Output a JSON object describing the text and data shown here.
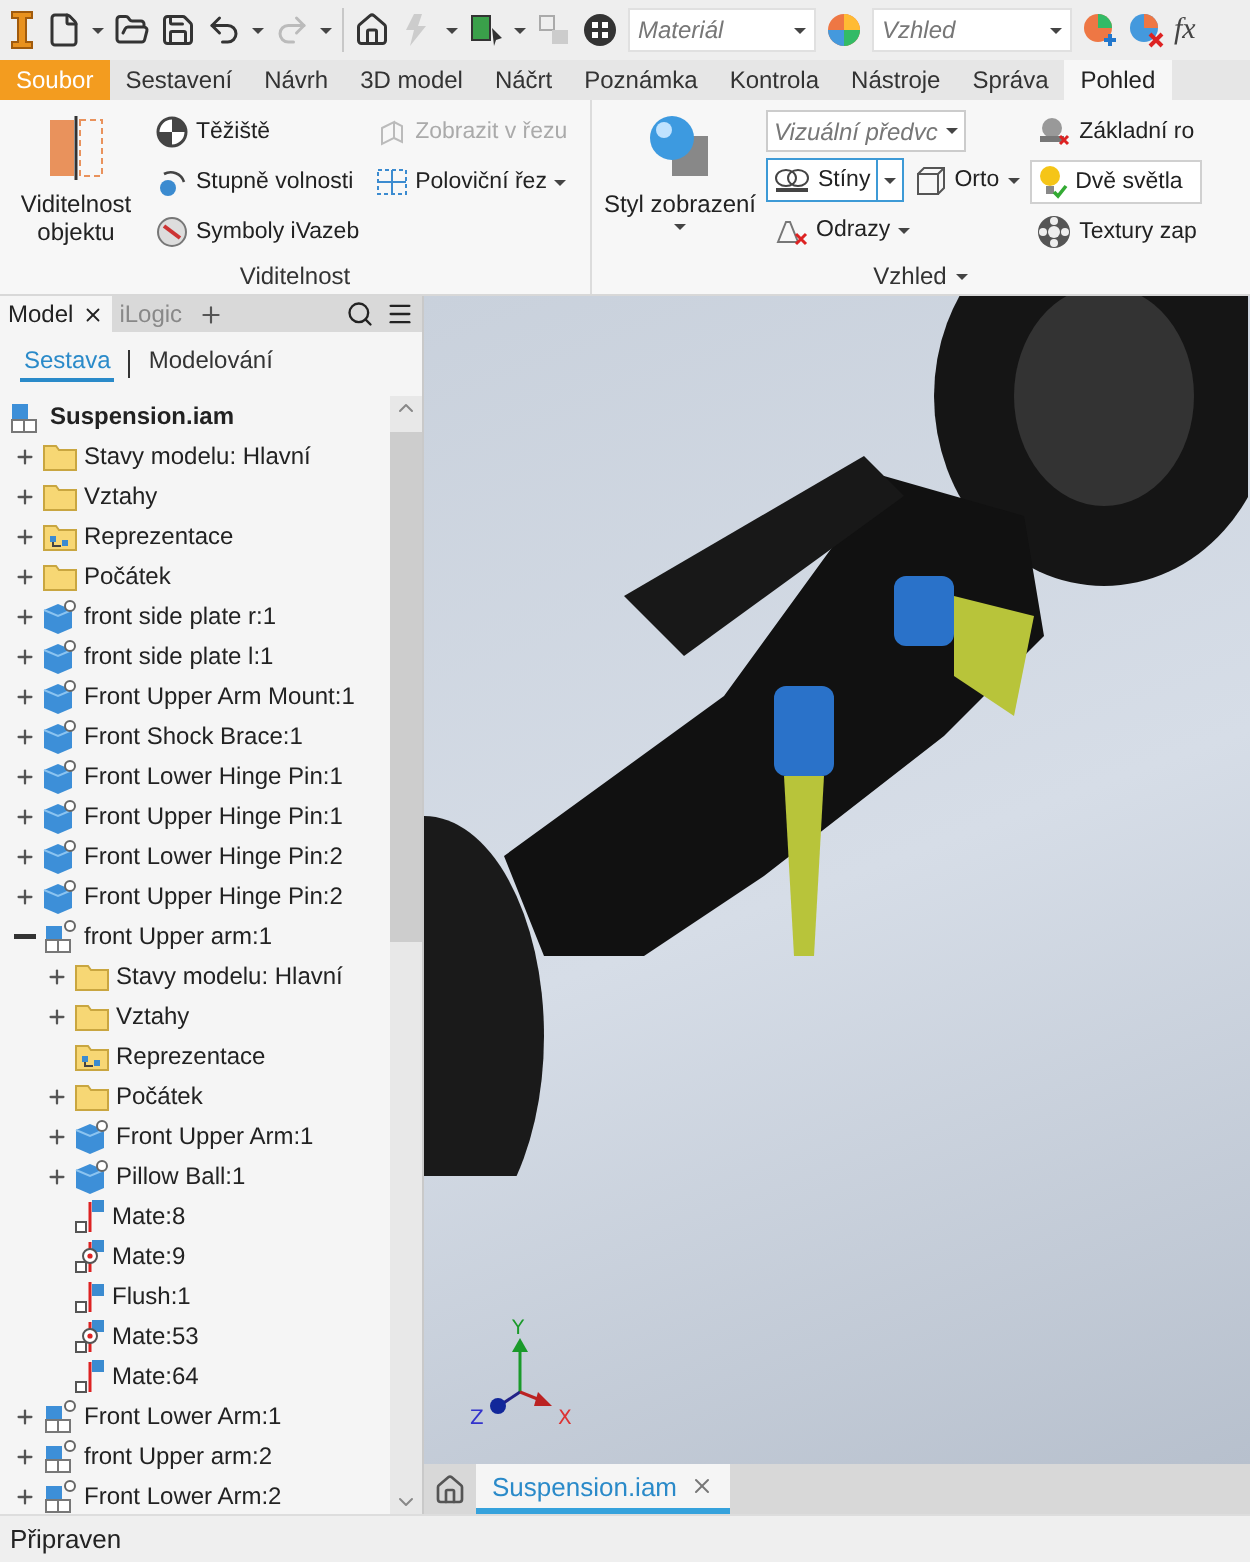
{
  "quick_access": {
    "material_field": {
      "placeholder": "Materiál"
    },
    "appearance_field": {
      "placeholder": "Vzhled"
    },
    "function_label": "fx"
  },
  "ribbon_tabs": [
    {
      "label": "Soubor",
      "kind": "file",
      "selected": false
    },
    {
      "label": "Sestavení",
      "kind": "tab",
      "selected": false
    },
    {
      "label": "Návrh",
      "kind": "tab",
      "selected": false
    },
    {
      "label": "3D model",
      "kind": "tab",
      "selected": false
    },
    {
      "label": "Náčrt",
      "kind": "tab",
      "selected": false
    },
    {
      "label": "Poznámka",
      "kind": "tab",
      "selected": false
    },
    {
      "label": "Kontrola",
      "kind": "tab",
      "selected": false
    },
    {
      "label": "Nástroje",
      "kind": "tab",
      "selected": false
    },
    {
      "label": "Správa",
      "kind": "tab",
      "selected": false
    },
    {
      "label": "Pohled",
      "kind": "tab",
      "selected": true
    }
  ],
  "visibility_panel": {
    "title": "Viditelnost",
    "big_button": "Viditelnost objektu",
    "column_1": [
      {
        "label": "Těžiště",
        "disabled": false
      },
      {
        "label": "Stupně volnosti",
        "disabled": false
      },
      {
        "label": "Symboly iVazeb",
        "disabled": false
      }
    ],
    "column_2": [
      {
        "label": "Zobrazit v řezu",
        "disabled": true,
        "dropdown": false
      },
      {
        "label": "Poloviční řez",
        "disabled": false,
        "dropdown": true
      }
    ]
  },
  "appearance_panel": {
    "title": "Vzhled",
    "big_button": "Styl zobrazení",
    "visual_style_field": {
      "placeholder": "Vizuální předvc"
    },
    "shadows": {
      "label": "Stíny",
      "selected": true
    },
    "ortho": {
      "label": "Orto"
    },
    "reflections": {
      "label": "Odrazy"
    },
    "column_3": [
      {
        "label": "Základní ro",
        "boxed": false
      },
      {
        "label": "Dvě světla",
        "boxed": true
      },
      {
        "label": "Textury zap",
        "boxed": false
      }
    ]
  },
  "browser": {
    "tabs": [
      {
        "label": "Model",
        "selected": true,
        "closable": true
      },
      {
        "label": "iLogic",
        "selected": false,
        "closable": false
      }
    ],
    "subtabs": [
      {
        "label": "Sestava",
        "selected": true
      },
      {
        "label": "Modelování",
        "selected": false
      }
    ],
    "root": "Suspension.iam",
    "tree": [
      {
        "label": "Stavy modelu: Hlavní",
        "kind": "folder",
        "expanded": false
      },
      {
        "label": "Vztahy",
        "kind": "folder",
        "expanded": false
      },
      {
        "label": "Reprezentace",
        "kind": "repfolder",
        "expanded": false
      },
      {
        "label": "Počátek",
        "kind": "folder",
        "expanded": false
      },
      {
        "label": "front side plate r:1",
        "kind": "part",
        "expanded": false
      },
      {
        "label": "front side plate l:1",
        "kind": "part",
        "expanded": false
      },
      {
        "label": "Front Upper Arm Mount:1",
        "kind": "part",
        "expanded": false
      },
      {
        "label": "Front Shock Brace:1",
        "kind": "part",
        "expanded": false
      },
      {
        "label": "Front Lower Hinge Pin:1",
        "kind": "part",
        "expanded": false
      },
      {
        "label": "Front Upper Hinge Pin:1",
        "kind": "part",
        "expanded": false
      },
      {
        "label": "Front Lower Hinge Pin:2",
        "kind": "part",
        "expanded": false
      },
      {
        "label": "Front Upper Hinge Pin:2",
        "kind": "part",
        "expanded": false
      },
      {
        "label": "front Upper arm:1",
        "kind": "assembly",
        "expanded": true,
        "children": [
          {
            "label": "Stavy modelu: Hlavní",
            "kind": "folder",
            "expanded": false
          },
          {
            "label": "Vztahy",
            "kind": "folder",
            "expanded": false
          },
          {
            "label": "Reprezentace",
            "kind": "repfolder"
          },
          {
            "label": "Počátek",
            "kind": "folder",
            "expanded": false
          },
          {
            "label": "Front Upper Arm:1",
            "kind": "part",
            "expanded": false
          },
          {
            "label": "Pillow Ball:1",
            "kind": "part",
            "expanded": false
          },
          {
            "label": "Mate:8",
            "kind": "mate"
          },
          {
            "label": "Mate:9",
            "kind": "mate-point"
          },
          {
            "label": "Flush:1",
            "kind": "flush"
          },
          {
            "label": "Mate:53",
            "kind": "mate-point"
          },
          {
            "label": "Mate:64",
            "kind": "mate"
          }
        ]
      },
      {
        "label": "Front Lower Arm:1",
        "kind": "assembly",
        "expanded": false
      },
      {
        "label": "front Upper arm:2",
        "kind": "assembly",
        "expanded": false
      },
      {
        "label": "Front Lower Arm:2",
        "kind": "assembly",
        "expanded": false
      }
    ]
  },
  "viewport": {
    "axes": {
      "y": "Y",
      "z": "Z",
      "x": "X"
    }
  },
  "document_tabs": [
    {
      "label": "Suspension.iam",
      "selected": true
    }
  ],
  "status_bar": "Připraven"
}
